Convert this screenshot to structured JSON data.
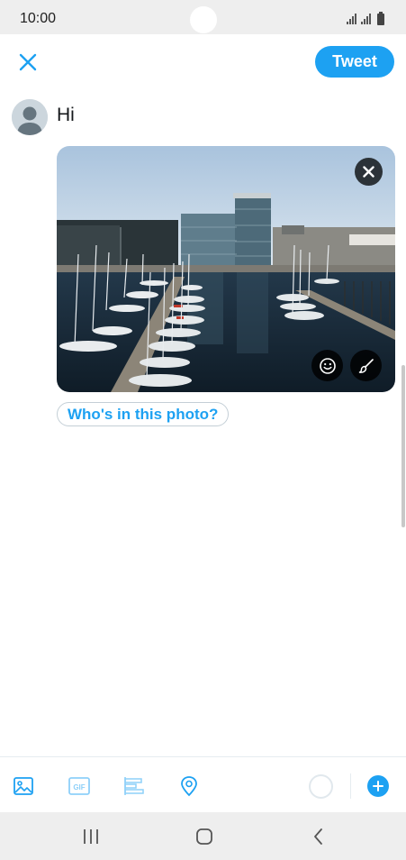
{
  "status_bar": {
    "time": "10:00",
    "icons": [
      "signal-icon",
      "signal-icon",
      "battery-icon"
    ]
  },
  "header": {
    "close_icon": "close-icon",
    "tweet_label": "Tweet"
  },
  "compose": {
    "text": "Hi",
    "avatar_icon": "default-avatar-icon"
  },
  "media": {
    "photo_description_icon": "harbor-photo",
    "remove_icon": "close-icon",
    "sticker_icon": "smiley-icon",
    "edit_icon": "brush-icon",
    "tag_people_label": "Who's in this photo?"
  },
  "toolbar": {
    "items": [
      "image-icon",
      "gif-icon",
      "poll-icon",
      "location-icon"
    ],
    "counter_progress": 0.0,
    "add_icon": "plus-icon"
  },
  "navbar": {
    "items": [
      "recent-apps-icon",
      "home-icon",
      "back-icon"
    ]
  },
  "colors": {
    "accent": "#1da1f2",
    "accent_light": "#8ed0f9",
    "bars": "#eeeeee"
  }
}
